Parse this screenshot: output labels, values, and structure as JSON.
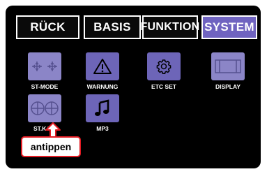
{
  "tabs": [
    {
      "label": "RÜCK",
      "active": false
    },
    {
      "label": "BASIS",
      "active": false
    },
    {
      "label": "FUNKTION",
      "active": false
    },
    {
      "label": "SYSTEM",
      "active": true
    }
  ],
  "menu": [
    {
      "label": "ST-MODE",
      "icon": "stick-mode-icon"
    },
    {
      "label": "WARNUNG",
      "icon": "warning-icon"
    },
    {
      "label": "ETC SET",
      "icon": "gear-icon"
    },
    {
      "label": "DISPLAY",
      "icon": "display-icon"
    },
    {
      "label": "ST.KALI",
      "icon": "stick-calibration-icon"
    },
    {
      "label": "MP3",
      "icon": "music-note-icon"
    }
  ],
  "callout": {
    "text": "antippen"
  },
  "colors": {
    "accent": "#6f63c0",
    "tile": "#6d65b8",
    "callout_border": "#e31b23"
  }
}
